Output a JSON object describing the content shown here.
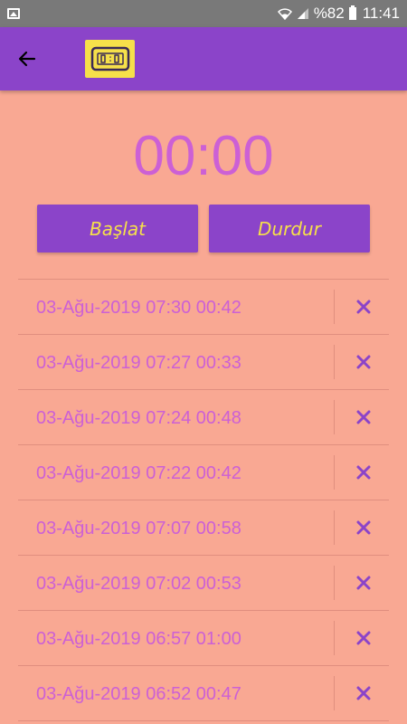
{
  "status_bar": {
    "battery": "%82",
    "time": "11:41"
  },
  "colors": {
    "background": "#f9a893",
    "app_bar": "#8b44c9",
    "accent_yellow": "#f6e04a",
    "text_pink": "#cc60d5"
  },
  "icons": {
    "back": "arrow-back-icon",
    "logo": "digital-clock-icon",
    "delete": "close-icon"
  },
  "timer": {
    "display": "00:00"
  },
  "buttons": {
    "start_label": "Başlat",
    "stop_label": "Durdur"
  },
  "records": [
    {
      "text": "03-Ağu-2019 07:30 00:42"
    },
    {
      "text": "03-Ağu-2019 07:27 00:33"
    },
    {
      "text": "03-Ağu-2019 07:24 00:48"
    },
    {
      "text": "03-Ağu-2019 07:22 00:42"
    },
    {
      "text": "03-Ağu-2019 07:07 00:58"
    },
    {
      "text": "03-Ağu-2019 07:02 00:53"
    },
    {
      "text": "03-Ağu-2019 06:57 01:00"
    },
    {
      "text": "03-Ağu-2019 06:52 00:47"
    }
  ]
}
